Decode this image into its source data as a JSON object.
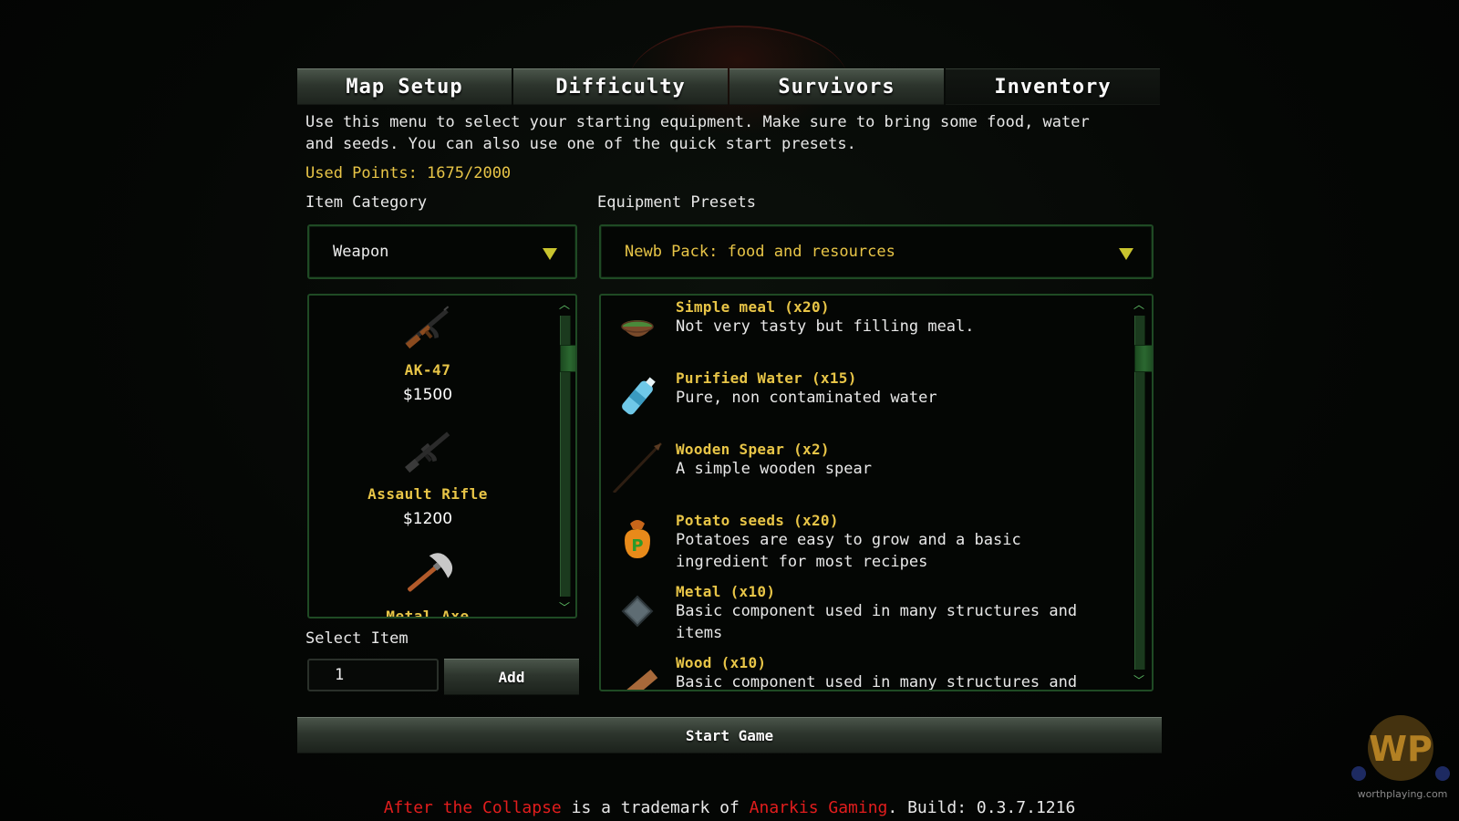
{
  "tabs": [
    {
      "label": "Map Setup",
      "active": false
    },
    {
      "label": "Difficulty",
      "active": false
    },
    {
      "label": "Survivors",
      "active": false
    },
    {
      "label": "Inventory",
      "active": true
    }
  ],
  "intro": "Use this menu to select your starting equipment. Make sure to bring some food, water and seeds. You can also use one of the quick start presets.",
  "used_points": "Used Points: 1675/2000",
  "item_category": {
    "label": "Item Category",
    "selected": "Weapon"
  },
  "equipment_presets": {
    "label": "Equipment Presets",
    "selected": "Newb Pack: food and resources"
  },
  "weapons": [
    {
      "name": "AK-47",
      "price": "$1500",
      "icon": "ak47-icon"
    },
    {
      "name": "Assault Rifle",
      "price": "$1200",
      "icon": "assault-rifle-icon"
    },
    {
      "name": "Metal Axe",
      "price": "",
      "icon": "metal-axe-icon"
    }
  ],
  "preset_items": [
    {
      "name": "Simple meal (x20)",
      "desc": "Not very tasty but filling meal.",
      "icon": "bowl-icon"
    },
    {
      "name": "Purified Water (x15)",
      "desc": "Pure, non contaminated water",
      "icon": "water-bottle-icon"
    },
    {
      "name": "Wooden Spear (x2)",
      "desc": "A simple wooden spear",
      "icon": "spear-icon"
    },
    {
      "name": "Potato seeds (x20)",
      "desc": "Potatoes are easy to grow and a basic ingredient for most recipes",
      "icon": "seed-bag-icon"
    },
    {
      "name": "Metal (x10)",
      "desc": "Basic component used in many structures and items",
      "icon": "metal-icon"
    },
    {
      "name": "Wood (x10)",
      "desc": "Basic component used in many structures and",
      "icon": "wood-icon"
    }
  ],
  "select_item": {
    "label": "Select Item",
    "quantity": "1",
    "add_label": "Add"
  },
  "start_game_label": "Start Game",
  "footer": {
    "game_name": "After the Collapse",
    "middle": " is a trademark of ",
    "company": "Anarkis Gaming",
    "build": ". Build: 0.3.7.1216"
  },
  "watermark": {
    "logo": "WP",
    "site": "worthplaying.com"
  },
  "colors": {
    "accent_yellow": "#e8c547",
    "panel_border": "#1f4a24",
    "trademark_red": "#e21d1d"
  }
}
